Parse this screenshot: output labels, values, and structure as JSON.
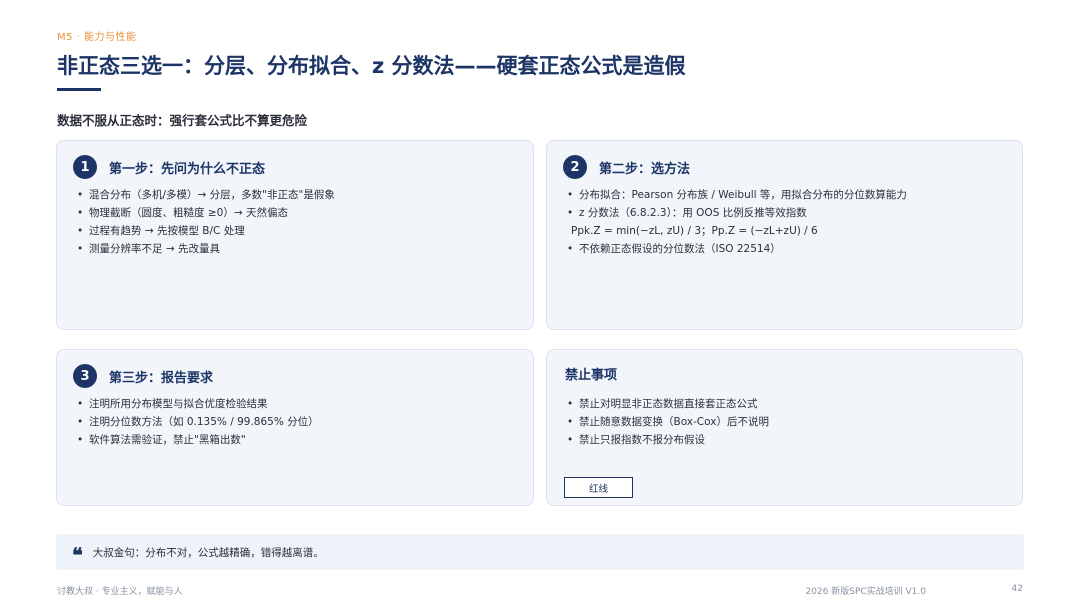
{
  "header": {
    "section_tag": "M5 · 能力与性能",
    "title": "非正态三选一：分层、分布拟合、z 分数法——硬套正态公式是造假",
    "subtitle": "数据不服从正态时：强行套公式比不算更危险"
  },
  "cards": [
    {
      "number": "1",
      "title": "第一步：先问为什么不正态",
      "items": [
        "混合分布（多机/多模）→ 分层，多数\"非正态\"是假象",
        "物理截断（圆度、粗糙度 ≥0）→ 天然偏态",
        "过程有趋势 → 先按模型 B/C 处理",
        "测量分辨率不足 → 先改量具"
      ]
    },
    {
      "number": "2",
      "title": "第二步：选方法",
      "items": [
        "分布拟合：Pearson 分布族 / Weibull 等，用拟合分布的分位数算能力",
        "z 分数法（6.8.2.3）：用 OOS 比例反推等效指数",
        "Ppk.Z = min(−zL, zU) / 3；Pp.Z = (−zL+zU) / 6",
        "不依赖正态假设的分位数法（ISO 22514）"
      ]
    },
    {
      "number": "3",
      "title": "第三步：报告要求",
      "items": [
        "注明所用分布模型与拟合优度检验结果",
        "注明分位数方法（如 0.135% / 99.865% 分位）",
        "软件算法需验证，禁止\"黑箱出数\""
      ]
    },
    {
      "title": "禁止事项",
      "items": [
        "禁止对明显非正态数据直接套正态公式",
        "禁止随意数据变换（Box-Cox）后不说明",
        "禁止只报指数不报分布假设"
      ],
      "button_label": "红线"
    }
  ],
  "quote": {
    "icon": "quote-icon",
    "text": "大叔金句：分布不对，公式越精确，错得越离谱。"
  },
  "footer": {
    "left": "讨教大叔 · 专业主义，赋能与人",
    "right": "2026 新版SPC实战培训 V1.0",
    "page_number": "42"
  },
  "colors": {
    "accent": "#1d3566",
    "tag": "#e8913a",
    "card_bg": "#f2f6fb"
  }
}
